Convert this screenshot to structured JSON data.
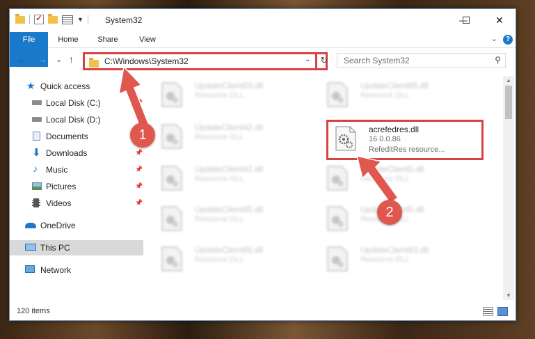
{
  "window": {
    "title": "System32",
    "controls": {
      "minimize": "—",
      "maximize": "☐",
      "close": "✕"
    }
  },
  "ribbon": {
    "tabs": [
      "File",
      "Home",
      "Share",
      "View"
    ],
    "help": "?"
  },
  "nav": {
    "back": "←",
    "forward": "→",
    "recent": "⌄",
    "up": "↑",
    "address": "C:\\Windows\\System32",
    "search_placeholder": "Search System32"
  },
  "sidebar": {
    "items": [
      {
        "label": "Quick access",
        "icon": "star-icon"
      },
      {
        "label": "Local Disk (C:)",
        "icon": "drive-icon"
      },
      {
        "label": "Local Disk (D:)",
        "icon": "drive-icon"
      },
      {
        "label": "Documents",
        "icon": "documents-icon"
      },
      {
        "label": "Downloads",
        "icon": "download-icon"
      },
      {
        "label": "Music",
        "icon": "music-icon"
      },
      {
        "label": "Pictures",
        "icon": "pictures-icon"
      },
      {
        "label": "Videos",
        "icon": "videos-icon"
      },
      {
        "label": "OneDrive",
        "icon": "cloud-icon"
      },
      {
        "label": "This PC",
        "icon": "computer-icon"
      },
      {
        "label": "Network",
        "icon": "network-icon"
      }
    ]
  },
  "files": [
    {
      "name": "UpdateClient63.dll",
      "desc": "Resource DLL"
    },
    {
      "name": "UpdateClient65.dll",
      "desc": "Resource DLL"
    },
    {
      "name": "UpdateClient42.dll",
      "desc": "Resource DLL"
    },
    {
      "name": "acrefedres.dll",
      "version": "16.0.0.86",
      "desc": "RefeditRes resource..."
    },
    {
      "name": "UpdateClient42.dll",
      "desc": "Resource DLL"
    },
    {
      "name": "UpdateClient5.dll",
      "desc": "Resource DLL"
    },
    {
      "name": "UpdateClient65.dll",
      "desc": "Resource DLL"
    },
    {
      "name": "UpdateClient5.dll",
      "desc": "Resource DLL"
    },
    {
      "name": "UpdateClient65.dll",
      "desc": "Resource DLL"
    },
    {
      "name": "UpdateClient63.dll",
      "desc": "Resource DLL"
    }
  ],
  "status": {
    "count": "120 items"
  },
  "callouts": [
    "1",
    "2"
  ],
  "colors": {
    "accent": "#1979ca",
    "highlight": "#d74244",
    "callout": "#e0574f"
  }
}
